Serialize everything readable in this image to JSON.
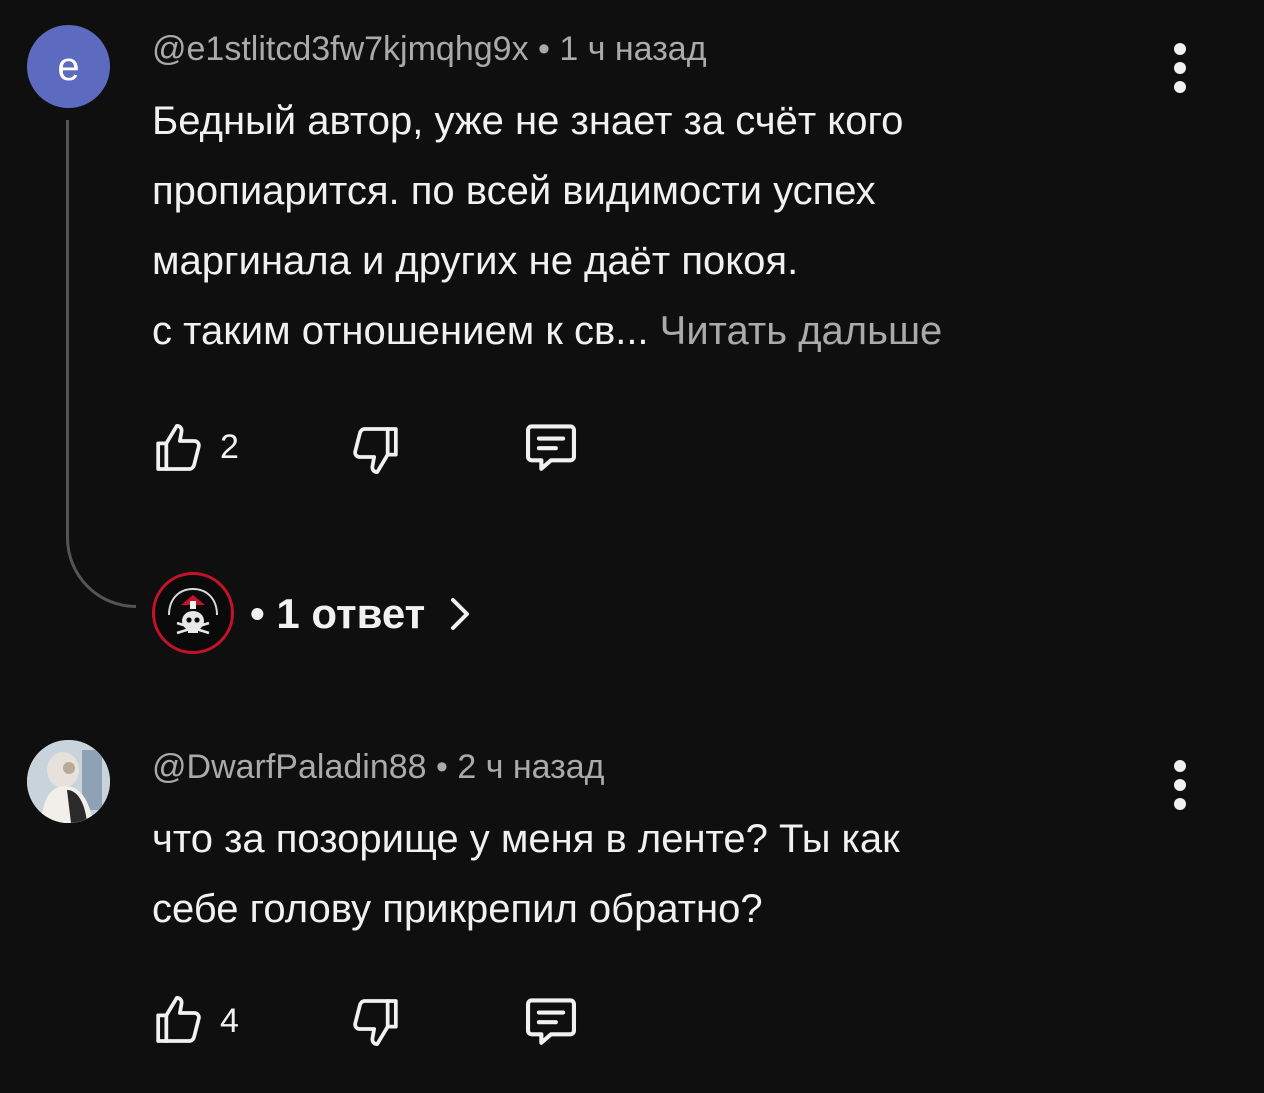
{
  "comments": [
    {
      "avatar_letter": "e",
      "avatar_color": "#5c6bc0",
      "author": "@e1stlitcd3fw7kjmqhg9x",
      "time": "• 1 ч назад",
      "text_lines": [
        "Бедный автор, уже не знает за счёт кого",
        "пропиарится. по всей видимости успех",
        "маргинала и других не даёт покоя.",
        "с таким отношением к св..."
      ],
      "read_more": "Читать дальше",
      "likes": "2",
      "replies_label": "• 1 ответ"
    },
    {
      "author": "@DwarfPaladin88",
      "time": "• 2 ч назад",
      "text_lines": [
        "что за позорище у меня в ленте? Ты как",
        "себе голову прикрепил обратно?"
      ],
      "likes": "4"
    }
  ],
  "icons": {
    "like": "thumb-up-icon",
    "dislike": "thumb-down-icon",
    "reply": "comment-icon",
    "menu": "more-vertical-icon",
    "chevron": "chevron-right-icon"
  },
  "colors": {
    "background": "#0f0f0f",
    "text": "#f1f1f1",
    "secondary": "#aaaaaa",
    "reply_avatar_ring": "#c4122a"
  }
}
